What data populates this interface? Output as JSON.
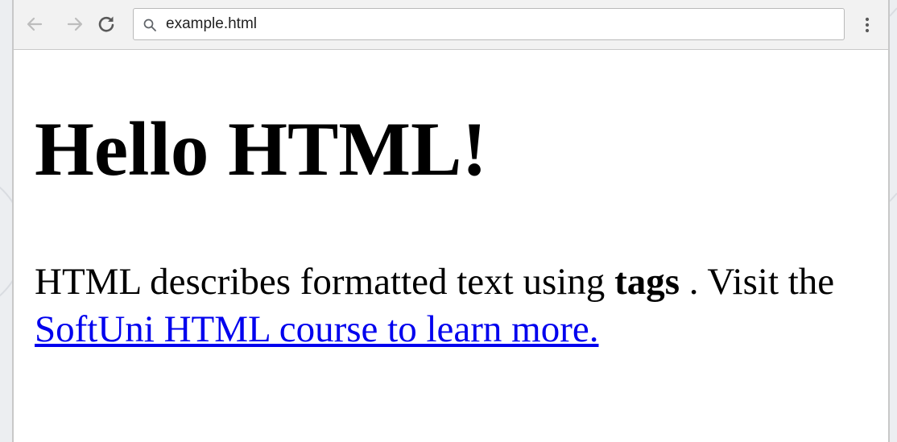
{
  "browser": {
    "address_value": "example.html",
    "icons": {
      "back": "arrow-left-icon",
      "forward": "arrow-right-icon",
      "reload": "reload-icon",
      "search": "search-icon",
      "menu": "more-vert-icon"
    }
  },
  "page": {
    "heading": "Hello HTML!",
    "paragraph": {
      "text_before": "HTML describes formatted text using ",
      "bold_word": "tags",
      "text_middle": " . Visit the ",
      "link_text": "SoftUni HTML course to learn more."
    }
  },
  "colors": {
    "link": "#0000ee",
    "toolbar_bg": "#f2f2f2",
    "page_bg": "#ffffff"
  }
}
